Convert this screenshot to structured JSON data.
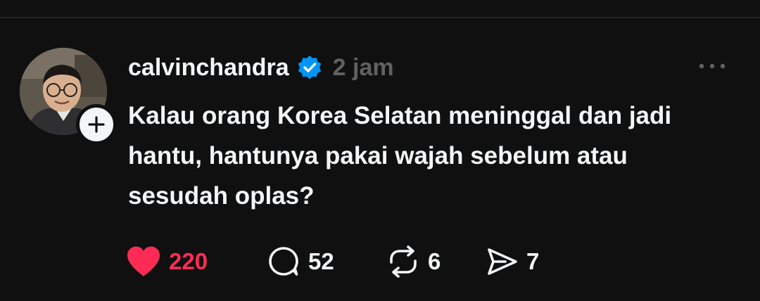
{
  "post": {
    "username": "calvinchandra",
    "verified": true,
    "time_ago": "2 jam",
    "text_lines": [
      "Kalau orang Korea Selatan meninggal dan jadi",
      "hantu, hantunya pakai wajah sebelum atau",
      "sesudah oplas?"
    ],
    "avatar_icon": "user-avatar-photo",
    "follow_icon": "plus-icon",
    "more_icon": "more-dots-icon"
  },
  "actions": {
    "like": {
      "icon": "heart-filled-icon",
      "count": "220",
      "liked": true
    },
    "reply": {
      "icon": "speech-bubble-icon",
      "count": "52"
    },
    "repost": {
      "icon": "repost-arrows-icon",
      "count": "6"
    },
    "share": {
      "icon": "send-paper-plane-icon",
      "count": "7"
    }
  },
  "colors": {
    "background": "#101010",
    "text": "#f3f5f7",
    "muted": "#616161",
    "like": "#fe2c55",
    "verified": "#0095f6"
  }
}
